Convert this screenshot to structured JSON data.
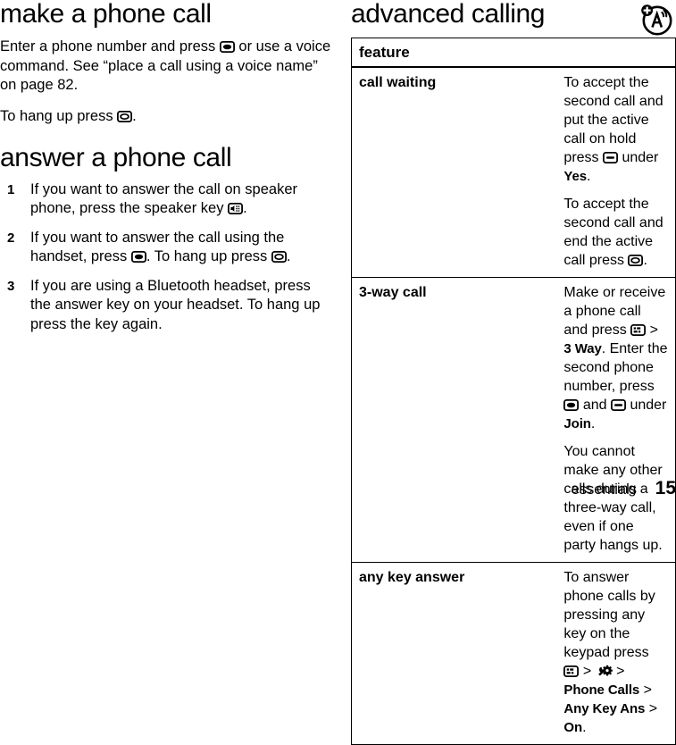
{
  "document": {
    "type": "phone-user-guide-page",
    "footer": {
      "chapter": "essentials",
      "page_number": "15"
    }
  },
  "left_column": {
    "section1": {
      "title": "make a phone call",
      "paragraph1_part1": "Enter a phone number and press ",
      "paragraph1_icon": "center-select-key-icon",
      "paragraph1_part2": " or use a voice command. See “place a call using a voice name” on page 82.",
      "paragraph2_part1": "To hang up press ",
      "paragraph2_icon": "end-call-key-icon",
      "paragraph2_part2": "."
    },
    "section2": {
      "title": "answer a phone call",
      "steps": [
        {
          "number": "1",
          "text_part1": "If you want to answer the call on speaker phone, press the speaker key ",
          "icon": "speaker-key-icon",
          "text_part2": "."
        },
        {
          "number": "2",
          "text_part1": "If you want to answer the call using the handset, press ",
          "icon": "center-select-key-icon",
          "text_part2": ". To hang up press ",
          "icon2": "end-call-key-icon",
          "text_part3": "."
        },
        {
          "number": "3",
          "text_part1": "If you are using a Bluetooth headset, press the answer key on your headset. To hang up press the key again.",
          "icon": "",
          "text_part2": ""
        }
      ]
    }
  },
  "right_column": {
    "title": "advanced calling",
    "corner_icon": "voice-command-icon",
    "table": {
      "header": "feature",
      "rows": [
        {
          "feature": "call waiting",
          "paragraphs": [
            {
              "part1": "To accept the second call and put the active call on hold press ",
              "icon": "soft-key-icon",
              "part2": " under ",
              "bold": "Yes",
              "part3": "."
            },
            {
              "part1": "To accept the second call and end the active call press ",
              "icon": "end-call-key-icon",
              "part2": ".",
              "bold": "",
              "part3": ""
            }
          ]
        },
        {
          "feature": "3-way call",
          "paragraphs": [
            {
              "part1": "Make or receive a phone call and press ",
              "icon": "menu-key-icon",
              "part2": " > ",
              "bold": "3 Way",
              "part3": ". Enter the second phone number, press ",
              "icon2": "center-select-key-icon",
              "part4": " and ",
              "icon3": "soft-key-icon",
              "part5": " under ",
              "bold2": "Join",
              "part6": "."
            },
            {
              "part1": "You cannot make any other calls during a three-way call, even if one party hangs up.",
              "icon": "",
              "part2": "",
              "bold": "",
              "part3": ""
            }
          ]
        },
        {
          "feature": "any key answer",
          "paragraphs": [
            {
              "part1": "To answer phone calls by pressing any key on the keypad press ",
              "icon": "menu-key-icon",
              "part2": " > ",
              "icon2": "settings-key-icon",
              "part3": " > ",
              "bold": "Phone Calls",
              "part4": " > ",
              "bold2": "Any Key Ans",
              "part5": " > ",
              "bold3": "On",
              "part6": "."
            }
          ]
        }
      ]
    }
  },
  "colors": {
    "text": "#000000",
    "background": "#ffffff",
    "rule": "#000000"
  }
}
